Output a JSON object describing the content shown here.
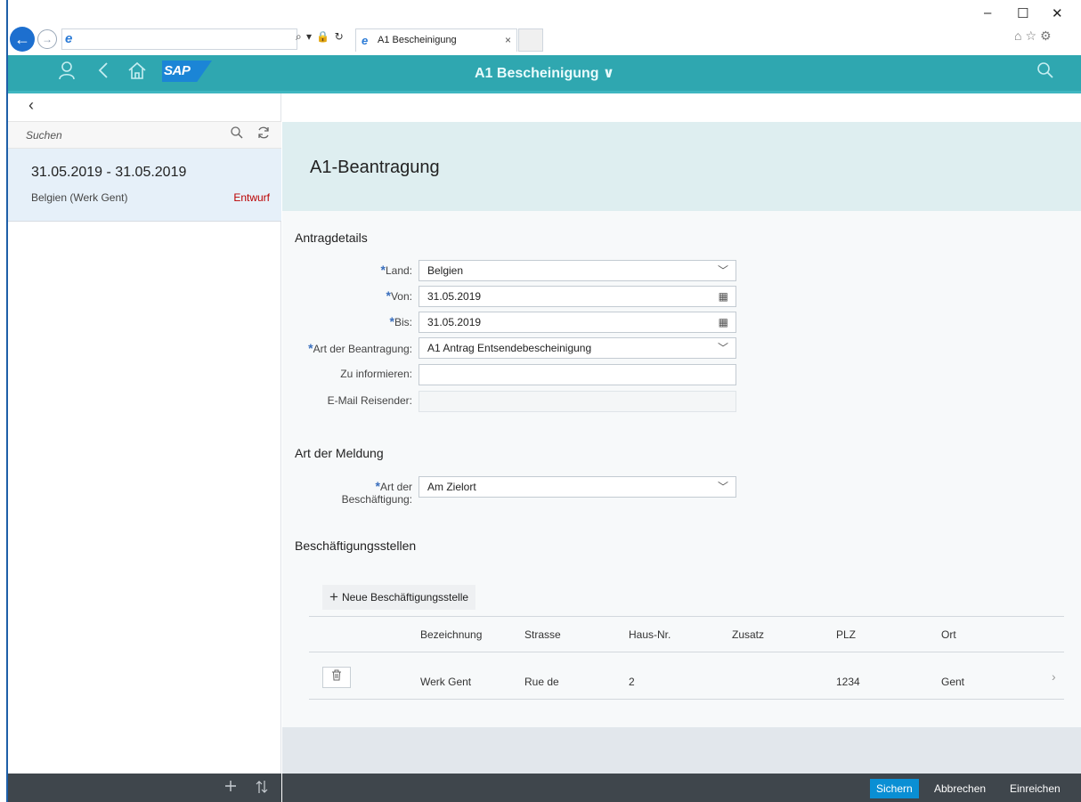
{
  "browser": {
    "tab_title": "A1 Bescheinigung",
    "tab_close": "×",
    "address_controls": "⌕ ▾ 🔒 ↻",
    "win_min": "–",
    "win_max": "☐",
    "win_close": "✕",
    "tool_icons": "⌂☆⚙"
  },
  "shell": {
    "title": "A1 Bescheinigung ∨",
    "logo_text": "SAP"
  },
  "master": {
    "back_glyph": "‹",
    "search_placeholder": "Suchen",
    "items": [
      {
        "title": "31.05.2019 - 31.05.2019",
        "subtitle": "Belgien (Werk Gent)",
        "status": "Entwurf"
      }
    ]
  },
  "detail": {
    "title": "A1-Beantragung",
    "sections": {
      "antragdetails": "Antragdetails",
      "meldung": "Art der Meldung",
      "stellen": "Beschäftigungsstellen"
    },
    "fields": {
      "land_label": "Land:",
      "land_value": "Belgien",
      "von_label": "Von:",
      "von_value": "31.05.2019",
      "bis_label": "Bis:",
      "bis_value": "31.05.2019",
      "art_label": "Art der Beantragung:",
      "art_value": "A1 Antrag Entsendebescheinigung",
      "info_label": "Zu informieren:",
      "info_value": "",
      "email_label": "E-Mail Reisender:",
      "email_value": "",
      "besch_label_1": "Art der",
      "besch_label_2": "Beschäftigung:",
      "besch_value": "Am Zielort"
    },
    "add_button": "Neue Beschäftigungsstelle",
    "table": {
      "headers": [
        "Bezeichnung",
        "Strasse",
        "Haus-Nr.",
        "Zusatz",
        "PLZ",
        "Ort"
      ],
      "rows": [
        [
          "Werk Gent",
          "Rue de",
          "2",
          "",
          "1234",
          "Gent"
        ]
      ]
    }
  },
  "footer": {
    "save": "Sichern",
    "cancel": "Abbrechen",
    "submit": "Einreichen"
  },
  "colors": {
    "shell": "#2fa7b0",
    "header": "#deeef0",
    "footer": "#3f464c",
    "primary": "#0a8fd4",
    "status_draft": "#bb0000"
  }
}
